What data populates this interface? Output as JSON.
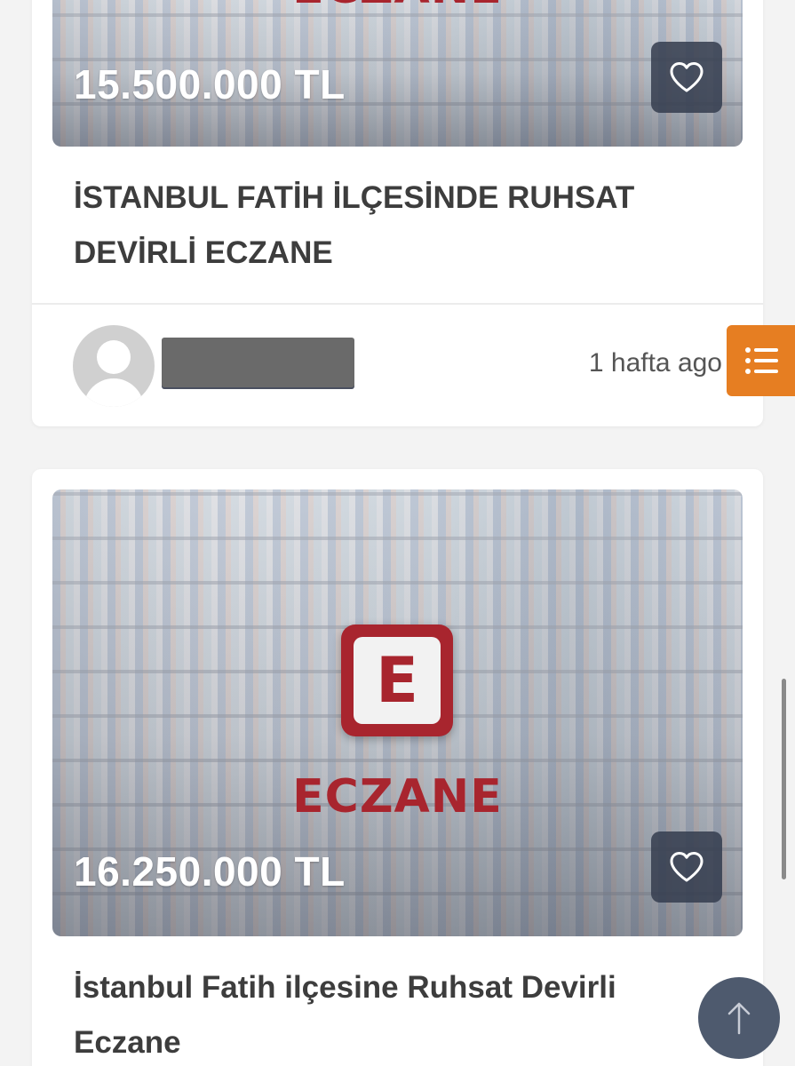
{
  "listings": [
    {
      "price": "15.500.000 TL",
      "image_brand_text": "ECZANE",
      "title": "İSTANBUL FATİH İLÇESİNDE RUHSAT DEVİRLİ ECZANE",
      "time_ago": "1 hafta ago",
      "favorite_icon": "heart-outline-icon"
    },
    {
      "price": "16.250.000 TL",
      "image_brand_text": "ECZANE",
      "image_logo_letter": "E",
      "title": "İstanbul Fatih ilçesine Ruhsat Devirli Eczane",
      "favorite_icon": "heart-outline-icon"
    }
  ],
  "ui": {
    "side_menu_icon": "list-icon",
    "scroll_top_icon": "arrow-up-icon"
  },
  "colors": {
    "accent": "#e67e22",
    "brand_red": "#a8252e",
    "fav_button_bg": "#343c4e",
    "scroll_button_bg": "#4e5a6e"
  }
}
